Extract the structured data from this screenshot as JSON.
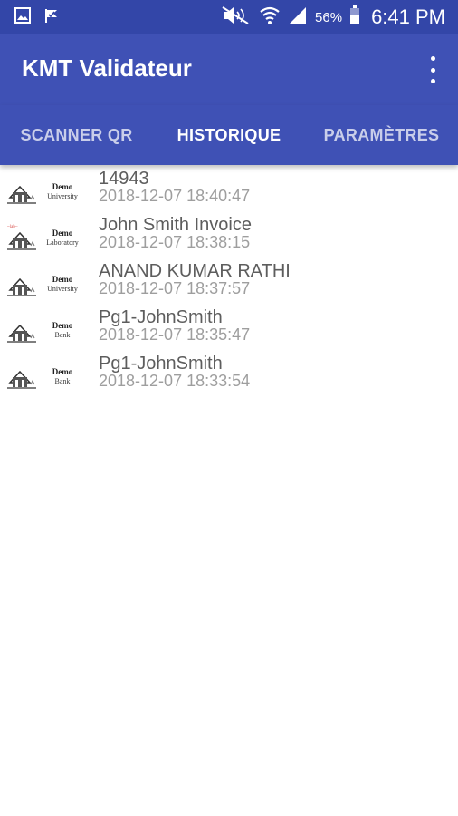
{
  "status_bar": {
    "icons_left": [
      "gallery-icon",
      "check-flag-icon"
    ],
    "icons_right": [
      "mute-icon",
      "wifi-icon",
      "signal-icon",
      "battery-icon"
    ],
    "battery_percent": "56%",
    "time": "6:41 PM"
  },
  "app_bar": {
    "title": "KMT Validateur",
    "menu_icon": "more-vert-icon"
  },
  "tabs": [
    {
      "label": "SCANNER QR",
      "active": false
    },
    {
      "label": "HISTORIQUE",
      "active": true
    },
    {
      "label": "PARAMÈTRES",
      "active": false
    }
  ],
  "history": [
    {
      "title": "14943",
      "date": "2018-12-07 18:40:47",
      "logo": {
        "line1": "Demo",
        "line2": "University",
        "accent": false
      }
    },
    {
      "title": "John Smith Invoice",
      "date": "2018-12-07 18:38:15",
      "logo": {
        "line1": "Demo",
        "line2": "Laboratory",
        "accent": true
      }
    },
    {
      "title": "ANAND KUMAR RATHI",
      "date": "2018-12-07 18:37:57",
      "logo": {
        "line1": "Demo",
        "line2": "University",
        "accent": false
      }
    },
    {
      "title": "Pg1-JohnSmith",
      "date": "2018-12-07 18:35:47",
      "logo": {
        "line1": "Demo",
        "line2": "Bank",
        "accent": false
      }
    },
    {
      "title": "Pg1-JohnSmith",
      "date": "2018-12-07 18:33:54",
      "logo": {
        "line1": "Demo",
        "line2": "Bank",
        "accent": false
      }
    }
  ],
  "colors": {
    "status_bar": "#3346a8",
    "primary": "#3f51b5",
    "title_text": "#5d5d5d",
    "date_text": "#9e9e9e"
  }
}
